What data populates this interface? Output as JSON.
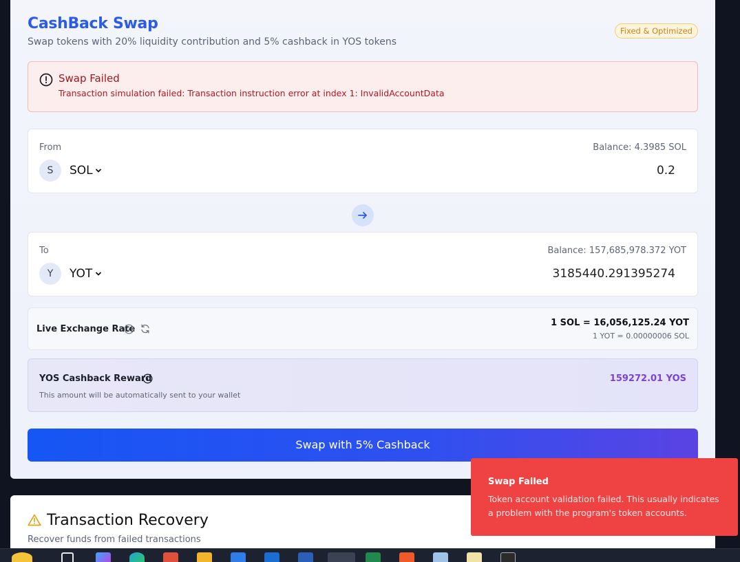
{
  "app": {
    "title": "CashBack Swap",
    "subtitle": "Swap tokens with 20% liquidity contribution and 5% cashback in YOS tokens",
    "badge": "Fixed & Optimized"
  },
  "error": {
    "title": "Swap Failed",
    "message": "Transaction simulation failed: Transaction instruction error at index 1: InvalidAccountData"
  },
  "from": {
    "label": "From",
    "balance": "Balance: 4.3985 SOL",
    "avatar": "S",
    "symbol": "SOL",
    "amount": "0.2"
  },
  "to": {
    "label": "To",
    "balance": "Balance: 157,685,978.372 YOT",
    "avatar": "Y",
    "symbol": "YOT",
    "amount": "3185440.291395274"
  },
  "rate": {
    "label": "Live Exchange Rate",
    "main": "1 SOL = 16,056,125.24 YOT",
    "inverse": "1 YOT = 0.00000006 SOL"
  },
  "cashback": {
    "title": "YOS Cashback Reward",
    "amount": "159272.01 YOS",
    "note": "This amount will be automatically sent to your wallet"
  },
  "swap_button": "Swap with 5% Cashback",
  "recovery": {
    "title": "Transaction Recovery",
    "subtitle": "Recover funds from failed transactions"
  },
  "toast": {
    "title": "Swap Failed",
    "message": "Token account validation failed. This usually indicates a problem with the program's token accounts."
  },
  "colors": {
    "accent": "#2b5ce8",
    "error": "#ef4242",
    "cashback": "#7a43d6"
  },
  "taskbar": {
    "icons": [
      "start-icon",
      "task-view-icon",
      "copilot-icon",
      "edge-icon",
      "app-icon",
      "file-explorer-icon",
      "store-icon",
      "outlook-icon",
      "word-icon",
      "chrome-icon",
      "excel-icon",
      "brave-icon",
      "notepad-icon",
      "notes-icon",
      "terminal-icon"
    ]
  }
}
